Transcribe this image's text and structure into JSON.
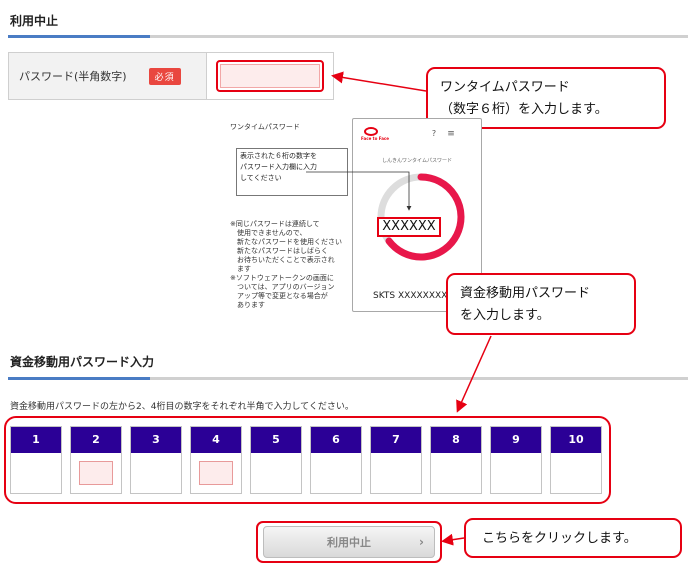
{
  "section1": {
    "title": "利用中止"
  },
  "password_row": {
    "label": "パスワード(半角数字)",
    "required_badge": "必須",
    "value": ""
  },
  "callouts": {
    "onetime_line1": "ワンタイムパスワード",
    "onetime_line2": "（数字６桁）を入力します。",
    "transfer_line1": "資金移動用パスワード",
    "transfer_line2": "を入力します。",
    "click": "こちらをクリックします。"
  },
  "illustration": {
    "label": "ワンタイムパスワード",
    "box_lines": [
      "表示された６桁の数字を",
      "パスワード入力欄に入力",
      "してください"
    ],
    "notes": [
      "※同じパスワードは連続して",
      "　使用できませんので、",
      "　新たなパスワードを使用ください",
      "　新たなパスワードはしばらく",
      "　お待ちいただくことで表示され",
      "　ます",
      "※ソフトウェアトークンの画面に",
      "　ついては、アプリのバージョン",
      "　アップ等で変更となる場合が",
      "　あります"
    ]
  },
  "phone": {
    "logo_text": "Face to Face",
    "app_title": "しんきんワンタイムパスワード",
    "help_glyph": "?",
    "menu_glyph": "≡",
    "code": "XXXXXX",
    "serial": "SKTS XXXXXXXX"
  },
  "section2": {
    "title": "資金移動用パスワード入力",
    "note": "資金移動用パスワードの左から2、4桁目の数字をそれぞれ半角で入力してください。"
  },
  "digits": [
    "1",
    "2",
    "3",
    "4",
    "5",
    "6",
    "7",
    "8",
    "9",
    "10"
  ],
  "submit": {
    "label": "利用中止",
    "chevron": "›"
  },
  "colors": {
    "accent_red": "#e60012",
    "digit_header": "#2b0096",
    "section_rule_blue": "#4a7cc4",
    "required_badge": "#e9473f"
  },
  "icons": [
    "help-icon",
    "menu-icon",
    "chevron-right-icon",
    "logo-icon"
  ]
}
